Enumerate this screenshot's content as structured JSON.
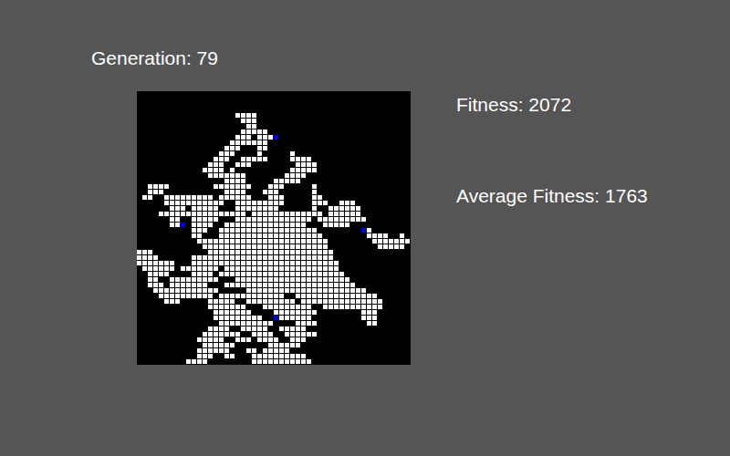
{
  "header": {
    "generation": "Generation: 79"
  },
  "stats": [
    {
      "label": "Fitness: 2072"
    },
    {
      "label": "Average Fitness: 1763"
    }
  ],
  "grid": {
    "cells": [
      [],
      [],
      [],
      [],
      [
        [
          18,
          21
        ]
      ],
      [
        [
          19,
          21
        ]
      ],
      [
        [
          20,
          21
        ]
      ],
      [
        [
          19,
          23
        ]
      ],
      [
        [
          18,
          20
        ],
        [
          22,
          24
        ]
      ],
      [
        [
          17,
          23
        ]
      ],
      [
        [
          16,
          18
        ],
        [
          22,
          23
        ]
      ],
      [
        [
          15,
          17
        ],
        [
          22,
          22
        ],
        [
          28,
          28
        ]
      ],
      [
        [
          14,
          16
        ],
        [
          19,
          23
        ],
        [
          28,
          31
        ]
      ],
      [
        [
          13,
          15
        ],
        [
          18,
          20
        ],
        [
          29,
          32
        ]
      ],
      [
        [
          12,
          15
        ],
        [
          17,
          17
        ],
        [
          28,
          32
        ]
      ],
      [
        [
          13,
          19
        ],
        [
          27,
          30
        ]
      ],
      [
        [
          16,
          19
        ],
        [
          25,
          29
        ]
      ],
      [
        [
          2,
          5
        ],
        [
          14,
          20
        ],
        [
          24,
          26
        ],
        [
          32,
          32
        ]
      ],
      [
        [
          2,
          4
        ],
        [
          16,
          19
        ],
        [
          23,
          25
        ],
        [
          32,
          32
        ]
      ],
      [
        [
          1,
          2
        ],
        [
          5,
          13
        ],
        [
          15,
          20
        ],
        [
          24,
          26
        ],
        [
          32,
          33
        ]
      ],
      [
        [
          5,
          15
        ],
        [
          18,
          26
        ],
        [
          32,
          34
        ],
        [
          37,
          39
        ]
      ],
      [
        [
          6,
          8
        ],
        [
          10,
          14
        ],
        [
          18,
          25
        ],
        [
          32,
          32
        ],
        [
          35,
          40
        ]
      ],
      [
        [
          4,
          19
        ],
        [
          21,
          33
        ],
        [
          35,
          40
        ]
      ],
      [
        [
          6,
          7
        ],
        [
          10,
          14
        ],
        [
          18,
          31
        ],
        [
          33,
          41
        ]
      ],
      [
        [
          6,
          7
        ],
        [
          10,
          13
        ],
        [
          16,
          30
        ],
        [
          34,
          38
        ]
      ],
      [
        [
          10,
          12
        ],
        [
          15,
          32
        ],
        [
          42,
          42
        ]
      ],
      [
        [
          10,
          11
        ],
        [
          15,
          33
        ],
        [
          42,
          45
        ],
        [
          48,
          48
        ]
      ],
      [
        [
          11,
          34
        ],
        [
          43,
          49
        ]
      ],
      [
        [
          12,
          34
        ],
        [
          44,
          48
        ]
      ],
      [
        [
          0,
          2
        ],
        [
          13,
          35
        ]
      ],
      [
        [
          0,
          3
        ],
        [
          10,
          35
        ]
      ],
      [
        [
          0,
          6
        ],
        [
          10,
          36
        ]
      ],
      [
        [
          1,
          6
        ],
        [
          8,
          14
        ],
        [
          16,
          36
        ]
      ],
      [
        [
          2,
          5
        ],
        [
          10,
          13
        ],
        [
          15,
          37
        ]
      ],
      [
        [
          2,
          3
        ],
        [
          6,
          14
        ],
        [
          18,
          38
        ]
      ],
      [
        [
          2,
          4
        ],
        [
          6,
          12
        ],
        [
          16,
          39
        ]
      ],
      [
        [
          3,
          14
        ],
        [
          20,
          41
        ]
      ],
      [
        [
          4,
          13
        ],
        [
          15,
          26
        ],
        [
          29,
          43
        ]
      ],
      [
        [
          5,
          7
        ],
        [
          13,
          17
        ],
        [
          20,
          28
        ],
        [
          30,
          44
        ]
      ],
      [
        [
          13,
          19
        ],
        [
          23,
          31
        ],
        [
          34,
          44
        ]
      ],
      [
        [
          14,
          20
        ],
        [
          25,
          32
        ],
        [
          41,
          43
        ]
      ],
      [
        [
          14,
          22
        ],
        [
          26,
          31
        ],
        [
          41,
          43
        ]
      ],
      [
        [
          15,
          24
        ],
        [
          29,
          32
        ],
        [
          42,
          43
        ]
      ],
      [
        [
          13,
          16
        ],
        [
          19,
          23
        ],
        [
          26,
          30
        ]
      ],
      [
        [
          12,
          18
        ],
        [
          21,
          24
        ],
        [
          27,
          32
        ]
      ],
      [
        [
          11,
          15
        ],
        [
          18,
          20
        ],
        [
          22,
          25
        ],
        [
          28,
          30
        ]
      ],
      [
        [
          12,
          17
        ],
        [
          24,
          29
        ]
      ],
      [
        [
          11,
          16
        ],
        [
          20,
          21
        ],
        [
          23,
          27
        ]
      ],
      [
        [
          11,
          13
        ],
        [
          16,
          17
        ],
        [
          21,
          30
        ]
      ],
      [
        [
          9,
          12
        ],
        [
          21,
          31
        ]
      ]
    ],
    "agents": [
      {
        "row": 8,
        "col": 25
      },
      {
        "row": 24,
        "col": 8
      },
      {
        "row": 25,
        "col": 41
      },
      {
        "row": 41,
        "col": 25
      }
    ]
  }
}
